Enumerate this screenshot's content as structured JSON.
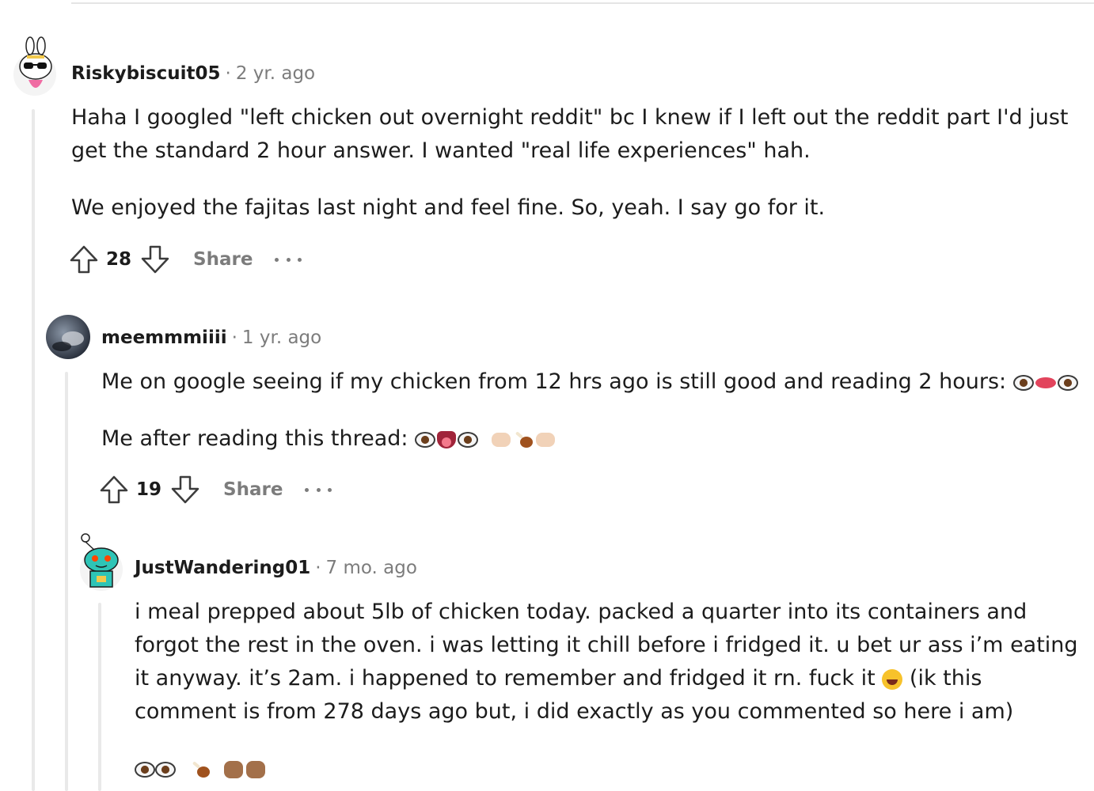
{
  "comments": [
    {
      "author": "Riskybiscuit05",
      "time": "2 yr. ago",
      "paragraphs": [
        "Haha I googled \"left chicken out overnight reddit\" bc I knew if I left out the reddit part I'd just get the standard 2 hour answer. I wanted \"real life experiences\" hah.",
        "We enjoyed the fajitas last night and feel fine. So, yeah. I say go for it."
      ],
      "score": "28",
      "share_label": "Share"
    },
    {
      "author": "meemmmiiii",
      "time": "1 yr. ago",
      "paragraphs": [
        "Me on google seeing if my chicken from 12 hrs ago is still good and reading 2 hours:",
        "Me after reading this thread:"
      ],
      "score": "19",
      "share_label": "Share"
    },
    {
      "author": "JustWandering01",
      "time": "7 mo. ago",
      "paragraphs": [
        "i meal prepped about 5lb of chicken today. packed a quarter into its containers and forgot the rest in the oven. i was letting it chill before i fridged it. u bet ur ass i’m eating it anyway. it’s 2am. i happened to remember and fridged it rn. fuck it",
        "(ik this comment is from 278 days ago but, i did exactly as you commented so here i am)"
      ]
    }
  ],
  "separator": "·",
  "icons": {
    "upvote": "upvote-arrow-icon",
    "downvote": "downvote-arrow-icon",
    "more": "ellipsis-icon",
    "emoji_eyes_lips": "eyes-lips-emoji",
    "emoji_eyes_tongue": "eyes-tongue-emoji",
    "emoji_hands_drumstick": "hands-drumstick-emoji",
    "emoji_laugh": "tears-of-joy-emoji"
  },
  "colors": {
    "meta_gray": "#7c7c7c",
    "thread_line": "#e9e9e9",
    "text": "#1c1c1c"
  }
}
